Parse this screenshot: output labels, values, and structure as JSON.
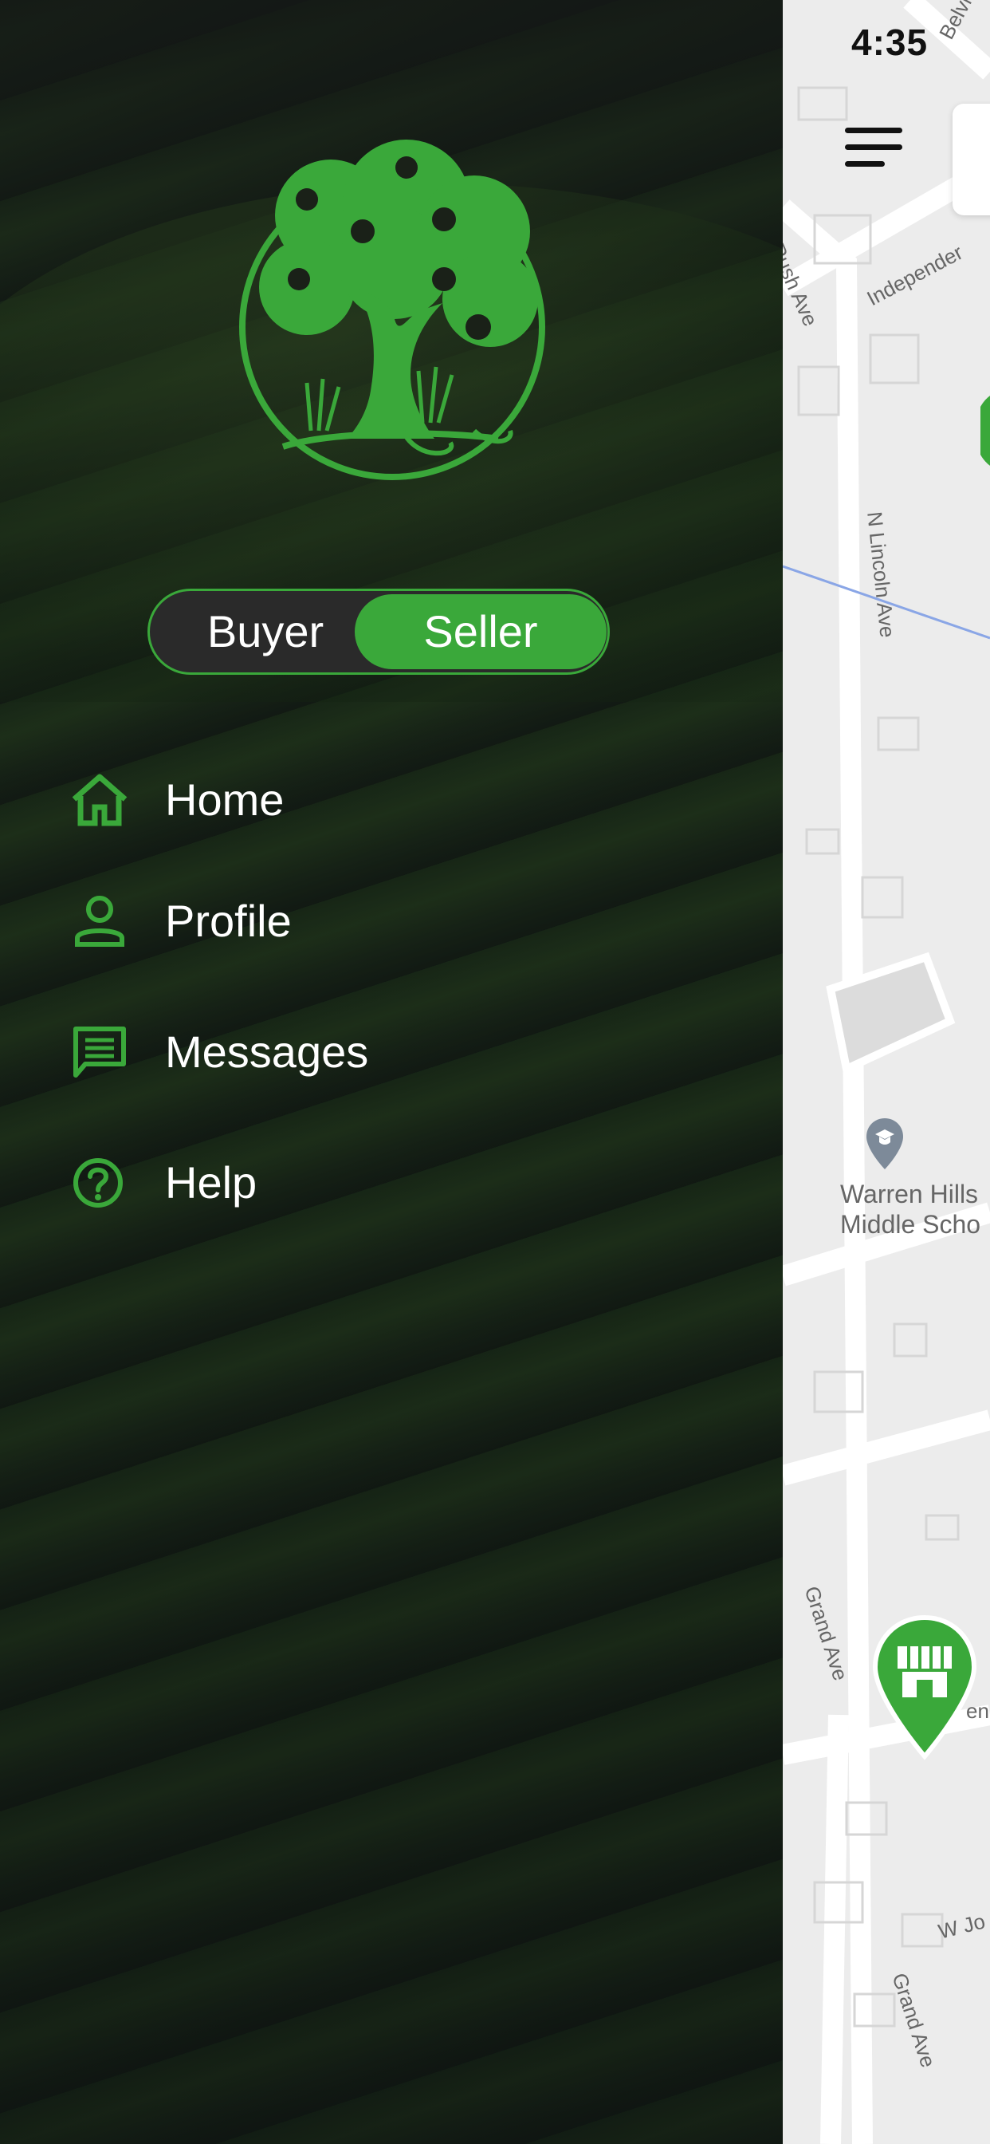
{
  "status_bar": {
    "time": "4:35"
  },
  "toggle": {
    "buyer_label": "Buyer",
    "seller_label": "Seller",
    "selected": "Seller"
  },
  "nav": {
    "items": [
      {
        "label": "Home",
        "icon": "home-icon"
      },
      {
        "label": "Profile",
        "icon": "person-icon"
      },
      {
        "label": "Messages",
        "icon": "message-icon"
      },
      {
        "label": "Help",
        "icon": "help-icon"
      }
    ]
  },
  "map": {
    "streets": {
      "belvidere": "Belvidere",
      "independence": "Independer",
      "rush": "Rush Ave",
      "lincoln": "N Lincoln Ave",
      "grand1": "Grand Ave",
      "grand2": "Grand Ave",
      "wjo": "W Jo",
      "en": "en"
    },
    "poi": {
      "line1": "Warren Hills",
      "line2": "Middle Scho"
    }
  },
  "colors": {
    "accent": "#3aa83a",
    "drawer_bg": "#1a2218",
    "map_bg": "#ececec"
  }
}
